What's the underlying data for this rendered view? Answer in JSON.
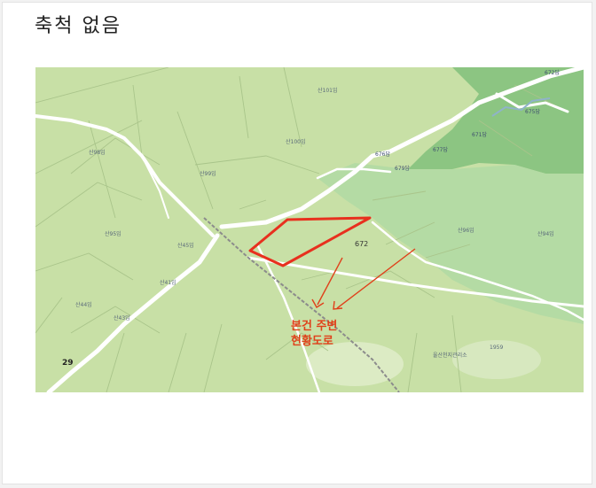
{
  "header": {
    "scale_note": "축척 없음"
  },
  "map": {
    "colors": {
      "base": "#c8e0a6",
      "forest": "#9ccf8e",
      "forest_dark": "#7fbf73",
      "road": "#ffffff",
      "parcel_line": "#a9c48a",
      "site_outline": "#e8301e",
      "annotation": "#e0401a"
    },
    "annotation": {
      "line1": "본건 주변",
      "line2": "현황도로"
    },
    "site_label": "672",
    "big_label": "29",
    "labels": [
      "산101임",
      "산100임",
      "672답",
      "675답",
      "671답",
      "677답",
      "676답",
      "679답",
      "산99임",
      "산98임",
      "산94임",
      "산96임",
      "산95임",
      "산45임",
      "산41임",
      "산44임",
      "산43임",
      "1959",
      "울산천지관리소",
      "29"
    ]
  }
}
